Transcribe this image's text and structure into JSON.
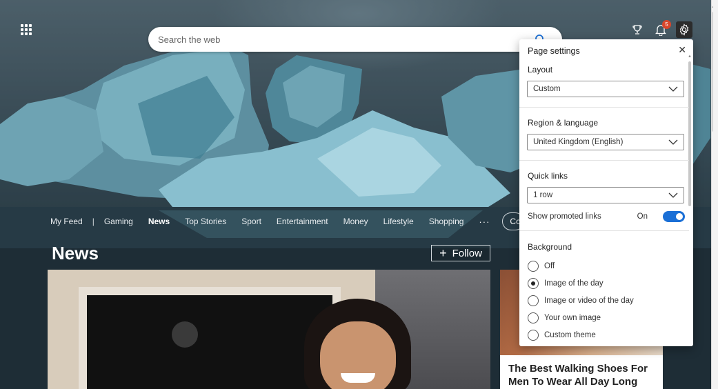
{
  "search": {
    "placeholder": "Search the web"
  },
  "notifications": {
    "count": "5"
  },
  "nav": {
    "items": [
      {
        "label": "My Feed",
        "active": false
      },
      {
        "label": "Gaming",
        "active": false
      },
      {
        "label": "News",
        "active": true
      },
      {
        "label": "Top Stories",
        "active": false
      },
      {
        "label": "Sport",
        "active": false
      },
      {
        "label": "Entertainment",
        "active": false
      },
      {
        "label": "Money",
        "active": false
      },
      {
        "label": "Lifestyle",
        "active": false
      },
      {
        "label": "Shopping",
        "active": false
      }
    ],
    "separator": "|",
    "more": "···",
    "pill": "Content"
  },
  "section": {
    "title": "News",
    "follow_label": "Follow",
    "follow_plus": "+"
  },
  "cards": {
    "right_title": "The Best Walking Shoes For Men To Wear All Day Long"
  },
  "settings": {
    "title": "Page settings",
    "close": "✕",
    "layout": {
      "label": "Layout",
      "value": "Custom"
    },
    "region": {
      "label": "Region & language",
      "value": "United Kingdom (English)"
    },
    "quick_links": {
      "label": "Quick links",
      "value": "1 row",
      "promoted_label": "Show promoted links",
      "promoted_state": "On"
    },
    "background": {
      "label": "Background",
      "options": [
        {
          "label": "Off",
          "checked": false
        },
        {
          "label": "Image of the day",
          "checked": true
        },
        {
          "label": "Image or video of the day",
          "checked": false
        },
        {
          "label": "Your own image",
          "checked": false
        },
        {
          "label": "Custom theme",
          "checked": false
        }
      ]
    }
  },
  "colors": {
    "accent": "#1a6fd6",
    "badge": "#d9462b",
    "arrow": "#e03a3a"
  }
}
